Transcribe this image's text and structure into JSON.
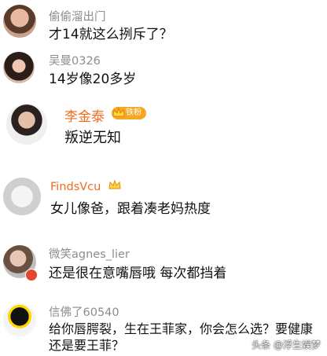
{
  "comments": [
    {
      "username": "偷偷溜出门",
      "text": "才14就这么挒斥了？"
    },
    {
      "username": "吴曼0326",
      "text": "14岁像20多岁"
    },
    {
      "username": "李金泰",
      "badge": "铁粉",
      "text": "叛逆无知"
    },
    {
      "username": "FindsVcu",
      "text": "女儿像爸，跟着凑老妈热度"
    },
    {
      "username": "微笑agnes_lier",
      "text": "还是很在意嘴唇哦 每次都挡着"
    },
    {
      "username": "信佛了60540",
      "text": "给你唇腭裂，生在王菲家，你会怎么选？要健康还是要王菲？"
    }
  ],
  "watermark": "头条 @浮生娱梦",
  "colors": {
    "vip_name": "#f26b1d",
    "badge": "#f5a623",
    "text": "#111111",
    "username": "#8c8c8c"
  }
}
